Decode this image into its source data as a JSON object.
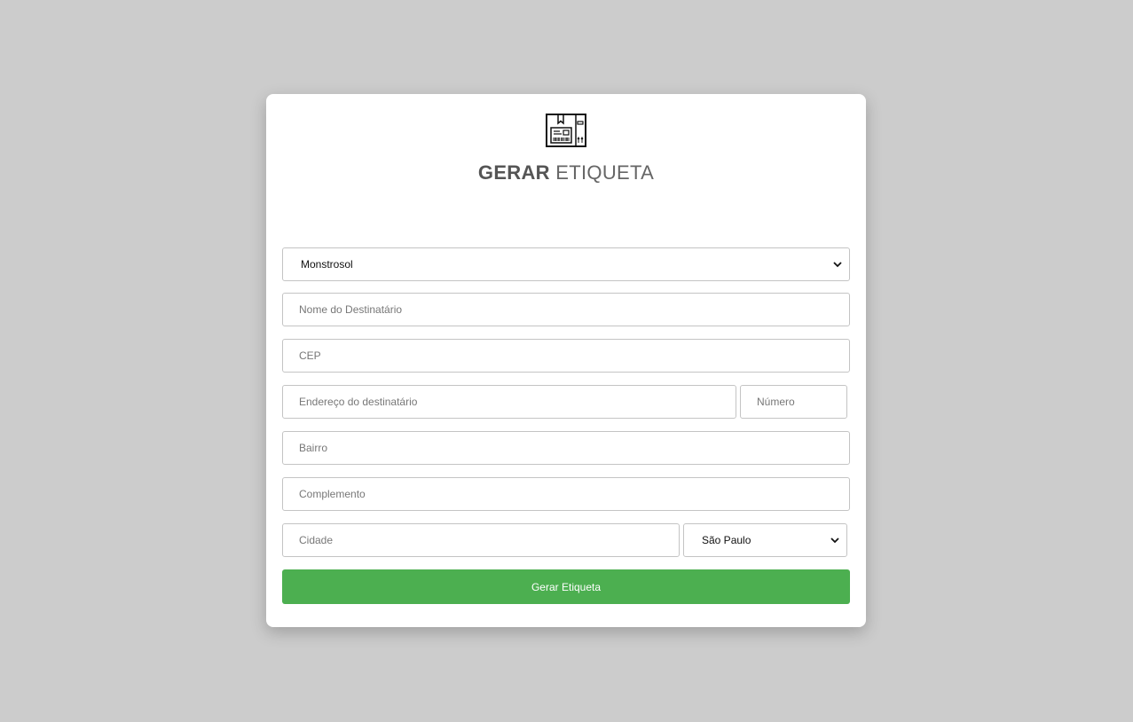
{
  "header": {
    "logo_icon": "package-label-icon",
    "title_bold": "GERAR",
    "title_light": "ETIQUETA"
  },
  "form": {
    "sender_select": {
      "selected": "Monstrosol",
      "icon": "chevron-down-icon"
    },
    "recipient_name": {
      "value": "",
      "placeholder": "Nome do Destinatário"
    },
    "cep": {
      "value": "",
      "placeholder": "CEP"
    },
    "address": {
      "value": "",
      "placeholder": "Endereço do destinatário"
    },
    "number": {
      "value": "",
      "placeholder": "Número"
    },
    "neighborhood": {
      "value": "",
      "placeholder": "Bairro"
    },
    "complement": {
      "value": "",
      "placeholder": "Complemento"
    },
    "city": {
      "value": "",
      "placeholder": "Cidade"
    },
    "state_select": {
      "selected": "São Paulo",
      "icon": "chevron-down-icon"
    },
    "submit_label": "Gerar Etiqueta"
  },
  "colors": {
    "background": "#cccccc",
    "card": "#ffffff",
    "primary_button": "#4caf50",
    "title_text": "#555555"
  }
}
